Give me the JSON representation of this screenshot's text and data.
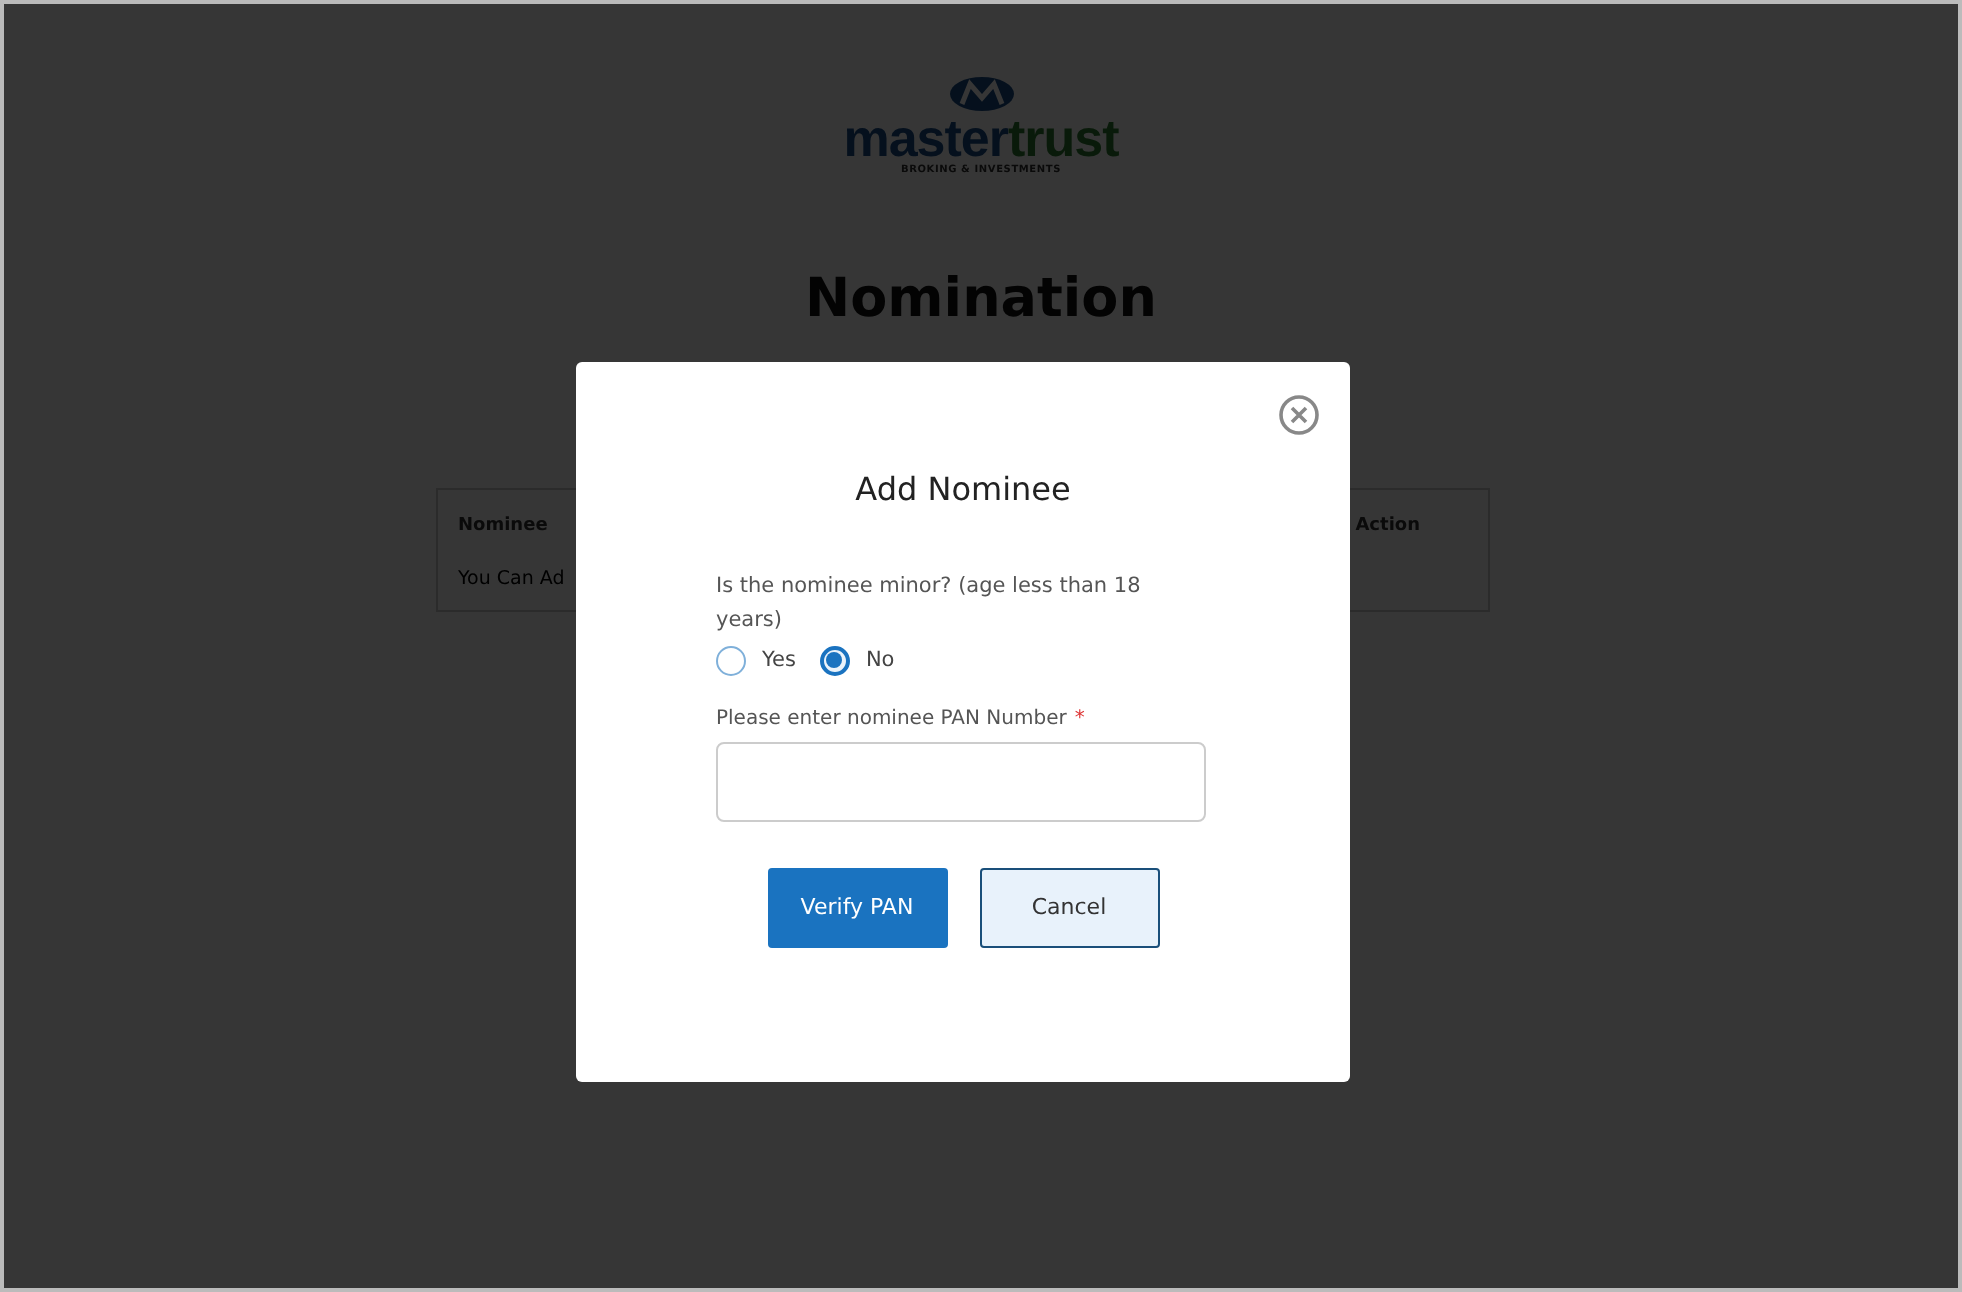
{
  "logo": {
    "wordmark": [
      "master",
      "trust"
    ],
    "tagline": "BROKING & INVESTMENTS"
  },
  "page_title": "Nomination",
  "table": {
    "columns": [
      "Nominee",
      "Action"
    ],
    "empty_message": "You Can Ad"
  },
  "modal": {
    "title": "Add Nominee",
    "question": "Is the nominee minor? (age less than 18 years)",
    "options": [
      {
        "label": "Yes",
        "selected": false
      },
      {
        "label": "No",
        "selected": true
      }
    ],
    "pan_field": {
      "label": "Please enter nominee PAN Number",
      "required_mark": "*"
    },
    "buttons": [
      {
        "label": "Verify PAN",
        "kind": "primary"
      },
      {
        "label": "Cancel",
        "kind": "secondary"
      }
    ]
  }
}
